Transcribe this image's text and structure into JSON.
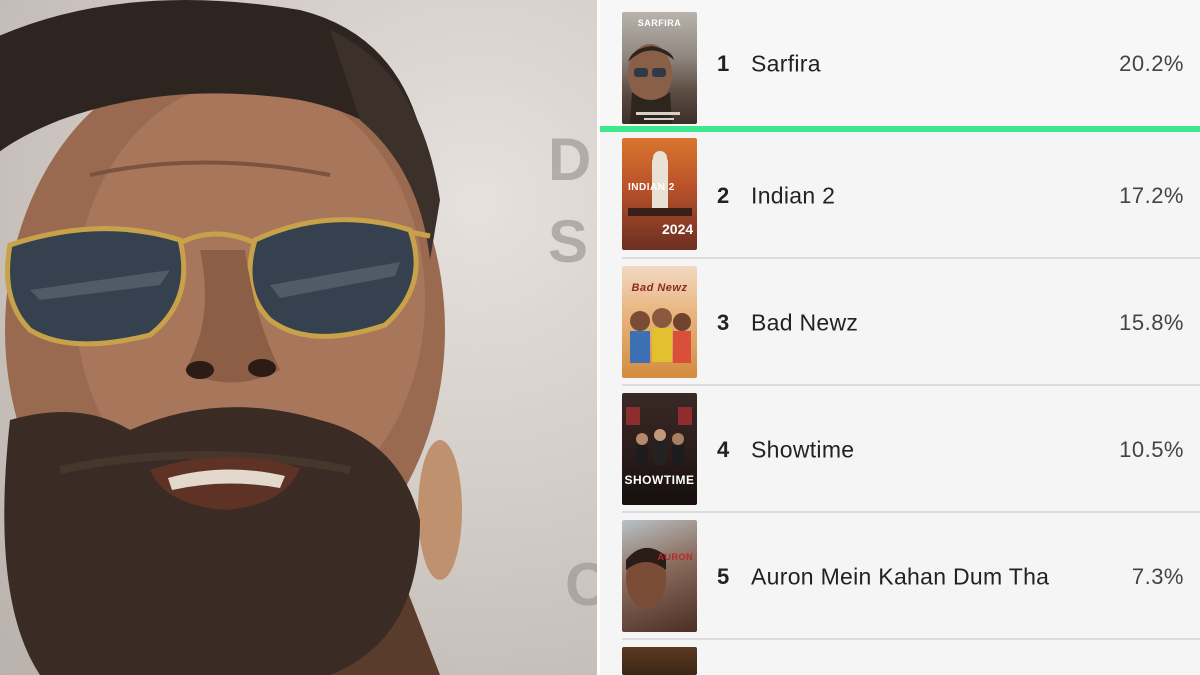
{
  "poll": {
    "rows": [
      {
        "rank": "1",
        "title": "Sarfira",
        "percent": "20.2%",
        "poster_text": "SARFIRA",
        "highlighted": true
      },
      {
        "rank": "2",
        "title": "Indian 2",
        "percent": "17.2%",
        "poster_text": "INDIAN 2",
        "highlighted": false
      },
      {
        "rank": "3",
        "title": "Bad Newz",
        "percent": "15.8%",
        "poster_text": "Bad Newz",
        "highlighted": false
      },
      {
        "rank": "4",
        "title": "Showtime",
        "percent": "10.5%",
        "poster_text": "SHOWTIME",
        "highlighted": false
      },
      {
        "rank": "5",
        "title": "Auron Mein Kahan Dum Tha",
        "percent": "7.3%",
        "poster_text": "AURON",
        "highlighted": false
      }
    ]
  },
  "colors": {
    "highlight": "#3ee88f",
    "separator": "#dcdcdc",
    "list_background": "#f5f5f5"
  }
}
